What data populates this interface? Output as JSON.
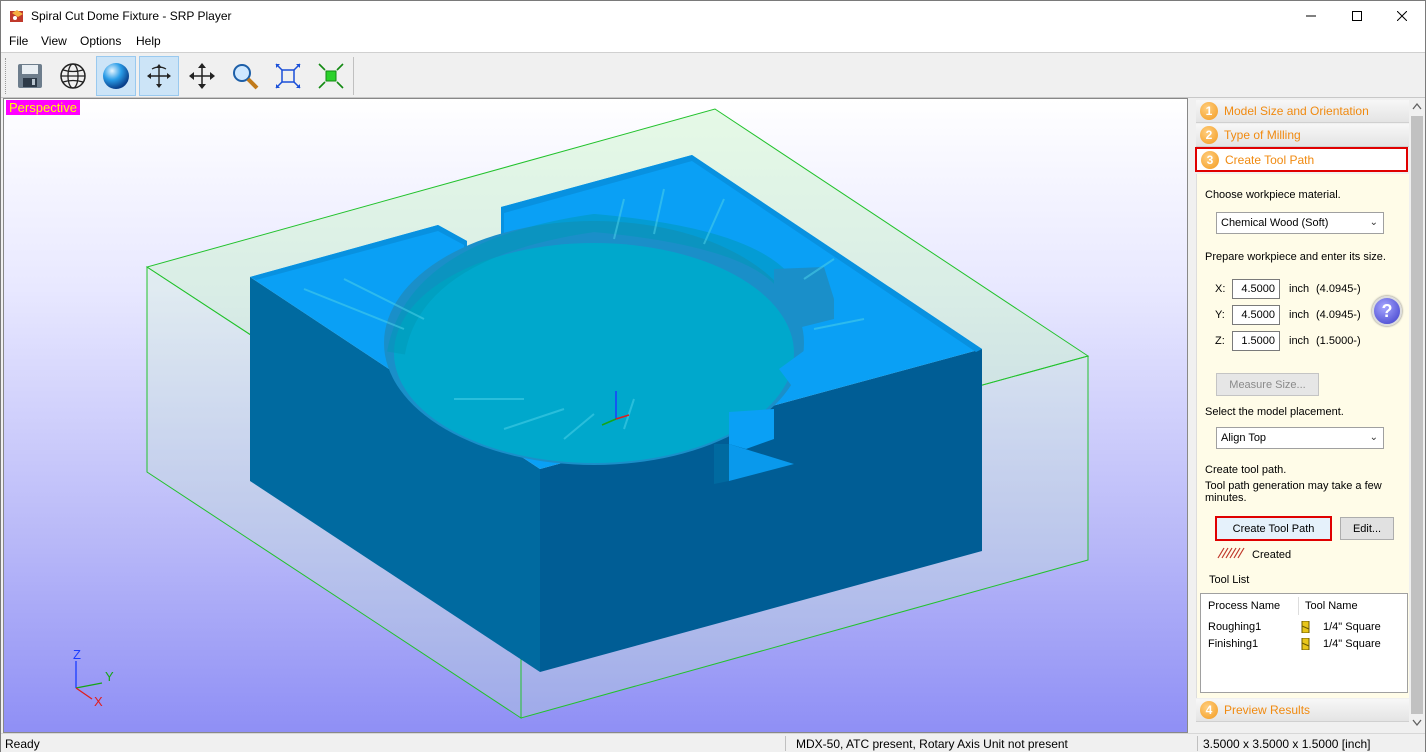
{
  "window": {
    "title": "Spiral Cut Dome Fixture - SRP Player",
    "minimize_icon": "minimize-icon",
    "maximize_icon": "maximize-icon",
    "close_icon": "close-icon"
  },
  "menu": [
    "File",
    "View",
    "Options",
    "Help"
  ],
  "toolbar": {
    "buttons": [
      "save-icon",
      "globe-icon",
      "sphere-icon",
      "rotate-icon",
      "pan-icon",
      "zoom-icon",
      "fit-icon",
      "shrink-icon"
    ],
    "active_index": 2
  },
  "viewport": {
    "label": "Perspective",
    "axes": {
      "z": "Z",
      "y": "Y",
      "x": "X"
    }
  },
  "panel": {
    "steps": [
      {
        "num": "1",
        "label": "Model Size and Orientation"
      },
      {
        "num": "2",
        "label": "Type of Milling"
      },
      {
        "num": "3",
        "label": "Create Tool Path"
      },
      {
        "num": "4",
        "label": "Preview Results"
      }
    ],
    "material_prompt": "Choose workpiece material.",
    "material_value": "Chemical Wood (Soft)",
    "size_prompt": "Prepare workpiece and enter its size.",
    "dims": [
      {
        "axis": "X:",
        "value": "4.5000",
        "unit": "inch",
        "hint": "(4.0945-)"
      },
      {
        "axis": "Y:",
        "value": "4.5000",
        "unit": "inch",
        "hint": "(4.0945-)"
      },
      {
        "axis": "Z:",
        "value": "1.5000",
        "unit": "inch",
        "hint": "(1.5000-)"
      }
    ],
    "measure_button": "Measure Size...",
    "placement_prompt": "Select the model placement.",
    "placement_value": "Align Top",
    "toolpath_prompt_1": "Create tool path.",
    "toolpath_prompt_2": "Tool path generation may take a few minutes.",
    "create_button": "Create Tool Path",
    "edit_button": "Edit...",
    "created_status": "Created",
    "tool_list_label": "Tool List",
    "tool_list": {
      "headers": [
        "Process Name",
        "Tool Name"
      ],
      "rows": [
        {
          "process": "Roughing1",
          "tool": "1/4\" Square"
        },
        {
          "process": "Finishing1",
          "tool": "1/4\" Square"
        }
      ]
    }
  },
  "status": {
    "left": "Ready",
    "middle": "MDX-50, ATC present, Rotary Axis Unit not present",
    "right": "3.5000 x 3.5000 x 1.5000 [inch]"
  }
}
